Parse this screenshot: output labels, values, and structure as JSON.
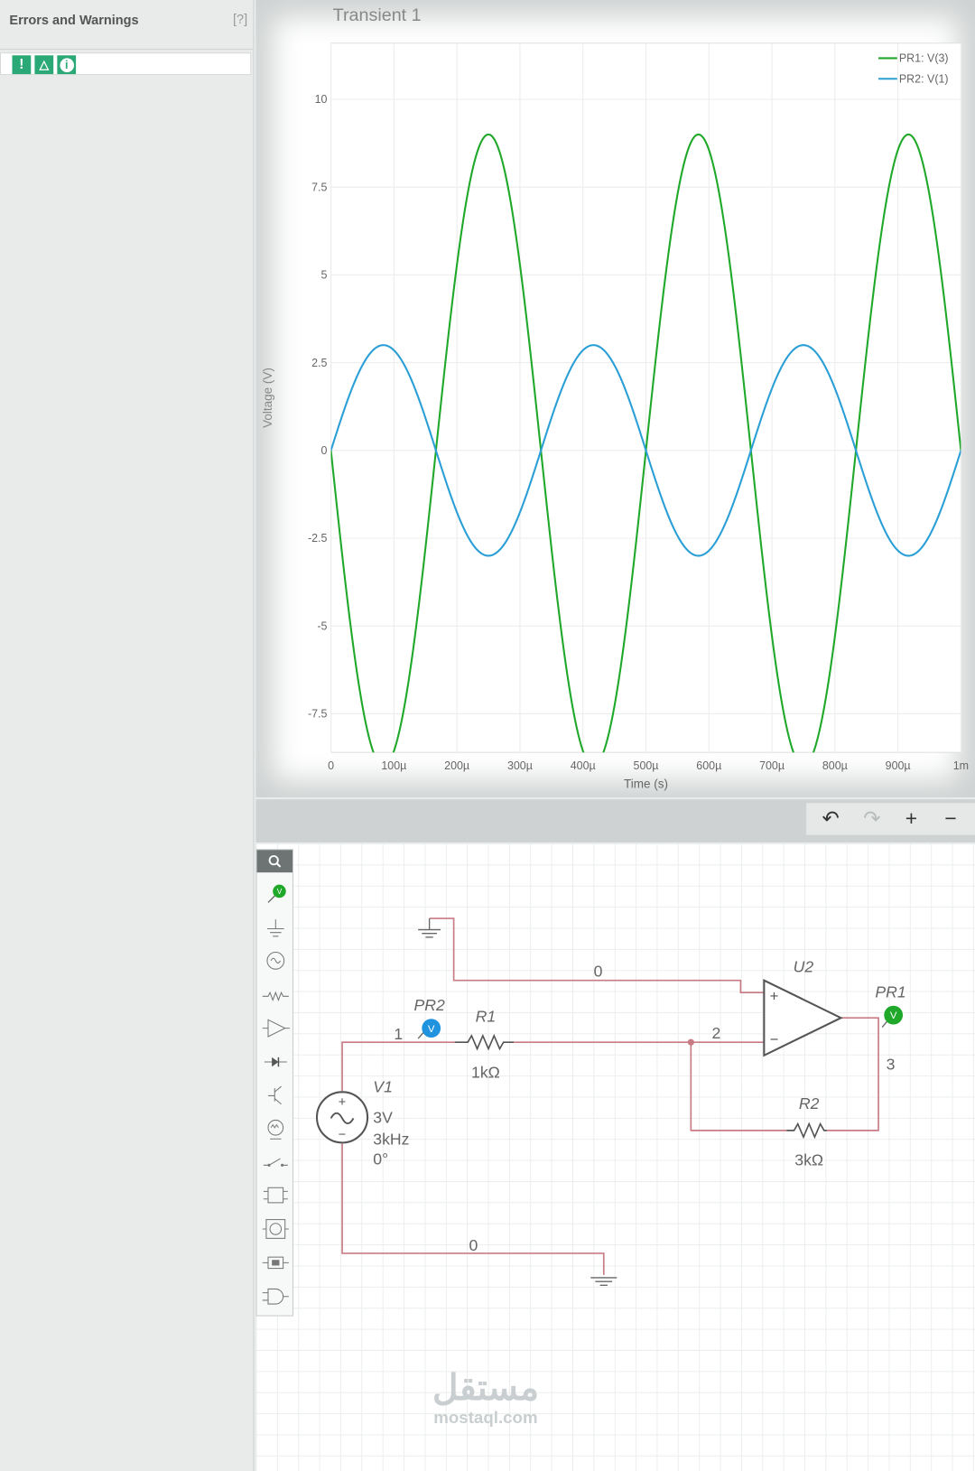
{
  "left_panel": {
    "title": "Errors and Warnings",
    "help": "[?]",
    "filters": [
      {
        "icon": "error-icon",
        "glyph": "!"
      },
      {
        "icon": "warning-icon",
        "glyph": "△"
      },
      {
        "icon": "info-icon",
        "glyph": "i"
      }
    ]
  },
  "chart_data": {
    "type": "line",
    "title": "Transient 1",
    "xlabel": "Time (s)",
    "ylabel": "Voltage (V)",
    "xlim": [
      0,
      0.001
    ],
    "ylim": [
      -8.6,
      11.6
    ],
    "x_ticks": [
      "0",
      "100µ",
      "200µ",
      "300µ",
      "400µ",
      "500µ",
      "600µ",
      "700µ",
      "800µ",
      "900µ",
      "1m"
    ],
    "y_ticks": [
      "10",
      "7.5",
      "5",
      "2.5",
      "0",
      "-2.5",
      "-5",
      "-7.5"
    ],
    "grid": true,
    "legend_position": "top-right",
    "series": [
      {
        "name": "PR1: V(3)",
        "color": "#1fa829",
        "amplitude": 9,
        "frequency_hz": 3000,
        "phase_deg": 180
      },
      {
        "name": "PR2: V(1)",
        "color": "#2a9fd6",
        "amplitude": 3,
        "frequency_hz": 3000,
        "phase_deg": 0
      }
    ]
  },
  "toolbar": {
    "undo": "↶",
    "redo": "↷",
    "zoom_in": "+",
    "zoom_out": "−"
  },
  "palette": {
    "items": [
      "probe-icon",
      "ground-icon",
      "ac-source-icon",
      "resistor-icon",
      "opamp-icon",
      "diode-icon",
      "transistor-icon",
      "lamp-icon",
      "switch-icon",
      "ic-icon",
      "meter-icon",
      "relay-icon",
      "and-gate-icon"
    ]
  },
  "circuit": {
    "ground_node_top": "0",
    "ground_node_bottom": "0",
    "node1": "1",
    "node2": "2",
    "node3": "3",
    "pr2": "PR2",
    "pr1": "PR1",
    "probe_letter": "V",
    "r1_name": "R1",
    "r1_value": "1kΩ",
    "r2_name": "R2",
    "r2_value": "3kΩ",
    "u2_name": "U2",
    "v1_name": "V1",
    "v1_amp": "3V",
    "v1_freq": "3kHz",
    "v1_phase": "0°",
    "wire_color": "#c97b85"
  },
  "watermark": {
    "arabic": "مستقل",
    "english": "mostaql.com"
  }
}
